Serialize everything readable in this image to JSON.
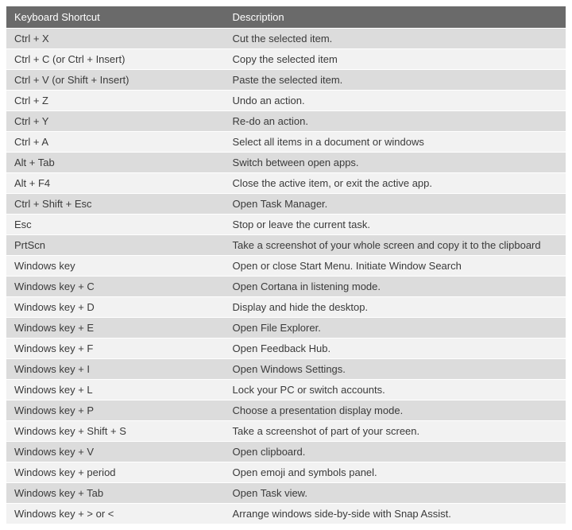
{
  "table": {
    "headers": {
      "shortcut": "Keyboard Shortcut",
      "description": "Description"
    },
    "rows": [
      {
        "shortcut": "Ctrl + X",
        "description": "Cut the selected item."
      },
      {
        "shortcut": "Ctrl + C (or Ctrl + Insert)",
        "description": "Copy the selected item"
      },
      {
        "shortcut": "Ctrl + V (or Shift + Insert)",
        "description": "Paste the selected item."
      },
      {
        "shortcut": "Ctrl + Z",
        "description": "Undo an action."
      },
      {
        "shortcut": "Ctrl + Y",
        "description": "Re-do an action."
      },
      {
        "shortcut": "Ctrl + A",
        "description": "Select all items in a document or windows"
      },
      {
        "shortcut": "Alt + Tab",
        "description": "Switch between open apps."
      },
      {
        "shortcut": "Alt + F4",
        "description": "Close the active item, or exit the active app."
      },
      {
        "shortcut": "Ctrl + Shift + Esc",
        "description": "Open Task Manager."
      },
      {
        "shortcut": "Esc",
        "description": "Stop or leave the current task."
      },
      {
        "shortcut": "PrtScn",
        "description": "Take a screenshot of your whole screen and copy it to the clipboard"
      },
      {
        "shortcut": "Windows key",
        "description": "Open or close Start Menu. Initiate Window Search"
      },
      {
        "shortcut": "Windows key + C",
        "description": "Open Cortana in listening mode."
      },
      {
        "shortcut": "Windows key + D",
        "description": "Display and hide the desktop."
      },
      {
        "shortcut": "Windows key + E",
        "description": "Open File Explorer."
      },
      {
        "shortcut": "Windows key + F",
        "description": "Open Feedback Hub."
      },
      {
        "shortcut": "Windows key + I",
        "description": "Open Windows Settings."
      },
      {
        "shortcut": "Windows key + L",
        "description": "Lock your PC or switch accounts."
      },
      {
        "shortcut": "Windows key + P",
        "description": "Choose a presentation display mode."
      },
      {
        "shortcut": "Windows key + Shift + S",
        "description": "Take a screenshot of part of your screen."
      },
      {
        "shortcut": "Windows key + V",
        "description": "Open clipboard."
      },
      {
        "shortcut": "Windows key + period",
        "description": "Open emoji and symbols panel."
      },
      {
        "shortcut": "Windows key + Tab",
        "description": "Open Task view."
      },
      {
        "shortcut": "Windows key + > or <",
        "description": "Arrange windows side-by-side with Snap Assist."
      }
    ]
  }
}
